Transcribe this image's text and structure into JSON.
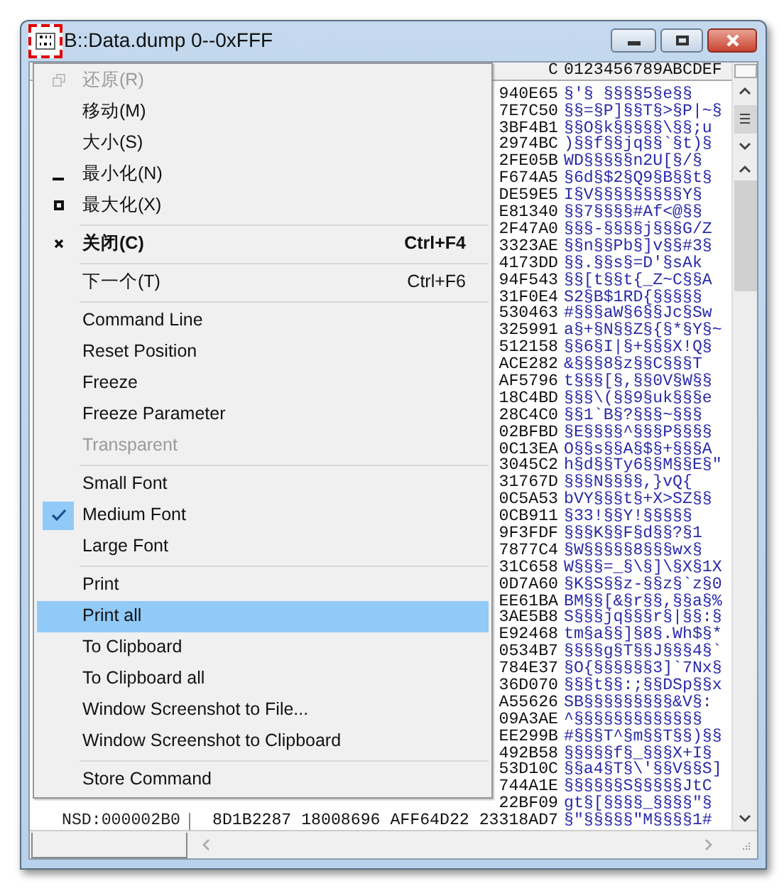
{
  "window": {
    "title": "B::Data.dump 0--0xFFF"
  },
  "dump": {
    "header_tail": "C",
    "header_ascii": "0123456789ABCDEF",
    "rows": [
      {
        "address": "",
        "hex": "940E65",
        "ascii": "§'§ §§§§5§e§§"
      },
      {
        "address": "",
        "hex": "7E7C50",
        "ascii": "§§=§P]§§T§>§P|~§"
      },
      {
        "address": "",
        "hex": "3BF4B1",
        "ascii": "§§O§k§§§§§\\§§;u"
      },
      {
        "address": "",
        "hex": "2974BC",
        "ascii": ")§§f§§jq§§`§t)§"
      },
      {
        "address": "",
        "hex": "2FE05B",
        "ascii": "WD§§§§§n2U[§/§"
      },
      {
        "address": "",
        "hex": "F674A5",
        "ascii": "§6d§$2§Q9§B§§t§"
      },
      {
        "address": "",
        "hex": "DE59E5",
        "ascii": "I§V§§§§§§§§§Y§"
      },
      {
        "address": "",
        "hex": "E81340",
        "ascii": "§§7§§§§#Af<@§§"
      },
      {
        "address": "",
        "hex": "2F47A0",
        "ascii": "§§§-§§§§j§§§G/Z"
      },
      {
        "address": "",
        "hex": "3323AE",
        "ascii": "§§n§§Pb§]v§§#3§"
      },
      {
        "address": "",
        "hex": "4173DD",
        "ascii": "§§.§§s§=D'§sAk"
      },
      {
        "address": "",
        "hex": "94F543",
        "ascii": "§§[t§§t{_Z~C§§A"
      },
      {
        "address": "",
        "hex": "31F0E4",
        "ascii": "S2§B$1RD{§§§§§"
      },
      {
        "address": "",
        "hex": "530463",
        "ascii": "#§§§aW§6§§Jc§Sw"
      },
      {
        "address": "",
        "hex": "325991",
        "ascii": "a§+§N§§Z§{§*§Y§~"
      },
      {
        "address": "",
        "hex": "512158",
        "ascii": "§§6§I|§+§§§X!Q§"
      },
      {
        "address": "",
        "hex": "ACE282",
        "ascii": "&§§§8§z§§C§§§T"
      },
      {
        "address": "",
        "hex": "AF5796",
        "ascii": "t§§§[§,§§0V§W§§"
      },
      {
        "address": "",
        "hex": "18C4BD",
        "ascii": "§§§\\(§§9§uk§§§e"
      },
      {
        "address": "",
        "hex": "28C4C0",
        "ascii": "§§1`B§?§§§~§§§"
      },
      {
        "address": "",
        "hex": "02BFBD",
        "ascii": "§E§§§§^§§§P§§§§"
      },
      {
        "address": "",
        "hex": "0C13EA",
        "ascii": "O§§s§§A§$§+§§§A"
      },
      {
        "address": "",
        "hex": "3045C2",
        "ascii": "h§d§§Ty6§§M§§E§\""
      },
      {
        "address": "",
        "hex": "31767D",
        "ascii": "§§§N§§§§,}vQ{"
      },
      {
        "address": "",
        "hex": "0C5A53",
        "ascii": "bVY§§§t§+X>SZ§§"
      },
      {
        "address": "",
        "hex": "0CB911",
        "ascii": "§33!§§Y!§§§§§"
      },
      {
        "address": "",
        "hex": "9F3FDF",
        "ascii": "§§§K§§F§d§§?§1"
      },
      {
        "address": "",
        "hex": "7877C4",
        "ascii": "§W§§§§§8§§§wx§"
      },
      {
        "address": "",
        "hex": "31C658",
        "ascii": "W§§§=_§\\§]\\§X§1X"
      },
      {
        "address": "",
        "hex": "0D7A60",
        "ascii": "§K§S§§z-§§z§`z§0"
      },
      {
        "address": "",
        "hex": "EE61BA",
        "ascii": "BM§§[&§r§§,§§a§%"
      },
      {
        "address": "",
        "hex": "3AE5B8",
        "ascii": "S§§§jq§§§r§|§§:§"
      },
      {
        "address": "",
        "hex": "E92468",
        "ascii": "tm§a§§]§8§.Wh$§*"
      },
      {
        "address": "",
        "hex": "0534B7",
        "ascii": "§§§§g§T§§J§§§4§`"
      },
      {
        "address": "",
        "hex": "784E37",
        "ascii": "§O{§§§§§§3]`7Nx§"
      },
      {
        "address": "",
        "hex": "36D070",
        "ascii": "§§§t§§:;§§DSp§§x"
      },
      {
        "address": "",
        "hex": "A55626",
        "ascii": "SB§§§§§§§§§&V§:"
      },
      {
        "address": "",
        "hex": "09A3AE",
        "ascii": "^§§§§§§§§§§§§§"
      },
      {
        "address": "",
        "hex": "EE299B",
        "ascii": "#§§§T^§m§§T§§)§§"
      },
      {
        "address": "",
        "hex": "492B58",
        "ascii": "§§§§§f§_§§§X+I§"
      },
      {
        "address": "",
        "hex": "53D10C",
        "ascii": "§§a4§T§\\'§§V§§S]"
      },
      {
        "address": "",
        "hex": "744A1E",
        "ascii": "§§§§§§S§§§§§JtC"
      },
      {
        "address": "",
        "hex": "22BF09",
        "ascii": "gt§[§§§§_§§§§\"§"
      },
      {
        "address": "NSD:000002B0",
        "hex": "8D1B2287 18008696 AFF64D22 23318AD7",
        "ascii": "§\"§§§§§\"M§§§§1#"
      }
    ]
  },
  "menu": {
    "sections": [
      [
        {
          "kind": "restore",
          "label": "还原(R)",
          "disabled": true,
          "bold": false,
          "checked": false,
          "selected": false
        },
        {
          "kind": "plain",
          "label": "移动(M)",
          "disabled": false,
          "bold": false,
          "checked": false,
          "selected": false
        },
        {
          "kind": "plain",
          "label": "大小(S)",
          "disabled": false,
          "bold": false,
          "checked": false,
          "selected": false
        },
        {
          "kind": "minimize",
          "label": "最小化(N)",
          "disabled": false,
          "bold": false,
          "checked": false,
          "selected": false
        },
        {
          "kind": "maximize",
          "label": "最大化(X)",
          "disabled": false,
          "bold": false,
          "checked": false,
          "selected": false
        }
      ],
      [
        {
          "kind": "close",
          "label": "关闭(C)",
          "shortcut": "Ctrl+F4",
          "disabled": false,
          "bold": true,
          "checked": false,
          "selected": false
        }
      ],
      [
        {
          "kind": "plain",
          "label": "下一个(T)",
          "shortcut": "Ctrl+F6",
          "disabled": false,
          "bold": false,
          "checked": false,
          "selected": false
        }
      ],
      [
        {
          "kind": "plain",
          "label": "Command Line",
          "disabled": false,
          "bold": false,
          "checked": false,
          "selected": false
        },
        {
          "kind": "plain",
          "label": "Reset Position",
          "disabled": false,
          "bold": false,
          "checked": false,
          "selected": false
        },
        {
          "kind": "plain",
          "label": "Freeze",
          "disabled": false,
          "bold": false,
          "checked": false,
          "selected": false
        },
        {
          "kind": "plain",
          "label": "Freeze Parameter",
          "disabled": false,
          "bold": false,
          "checked": false,
          "selected": false
        },
        {
          "kind": "plain",
          "label": "Transparent",
          "disabled": true,
          "bold": false,
          "checked": false,
          "selected": false
        }
      ],
      [
        {
          "kind": "plain",
          "label": "Small Font",
          "disabled": false,
          "bold": false,
          "checked": false,
          "selected": false
        },
        {
          "kind": "plain",
          "label": "Medium Font",
          "disabled": false,
          "bold": false,
          "checked": true,
          "selected": false
        },
        {
          "kind": "plain",
          "label": "Large Font",
          "disabled": false,
          "bold": false,
          "checked": false,
          "selected": false
        }
      ],
      [
        {
          "kind": "plain",
          "label": "Print",
          "disabled": false,
          "bold": false,
          "checked": false,
          "selected": false
        },
        {
          "kind": "plain",
          "label": "Print all",
          "disabled": false,
          "bold": false,
          "checked": false,
          "selected": true
        },
        {
          "kind": "plain",
          "label": "To Clipboard",
          "disabled": false,
          "bold": false,
          "checked": false,
          "selected": false
        },
        {
          "kind": "plain",
          "label": "To Clipboard all",
          "disabled": false,
          "bold": false,
          "checked": false,
          "selected": false
        },
        {
          "kind": "plain",
          "label": "Window Screenshot to File...",
          "disabled": false,
          "bold": false,
          "checked": false,
          "selected": false
        },
        {
          "kind": "plain",
          "label": "Window Screenshot to Clipboard",
          "disabled": false,
          "bold": false,
          "checked": false,
          "selected": false
        }
      ],
      [
        {
          "kind": "plain",
          "label": "Store Command",
          "disabled": false,
          "bold": false,
          "checked": false,
          "selected": false
        }
      ]
    ]
  }
}
